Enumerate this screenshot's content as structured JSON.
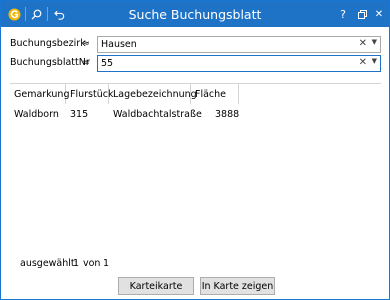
{
  "window": {
    "title": "Suche Buchungsblatt",
    "help_label": "?",
    "close_label": "✕"
  },
  "form": {
    "bezirk_label": "Buchungsbezirk",
    "bezirk_operator": "≈",
    "bezirk_value": "Hausen",
    "nr_label": "BuchungsblattNr",
    "nr_operator": "=",
    "nr_value": "55",
    "clear_glyph": "✕",
    "dropdown_glyph": "▼"
  },
  "table": {
    "columns": [
      "Gemarkung",
      "Flurstück",
      "Lagebezeichnung",
      "Fläche"
    ],
    "rows": [
      [
        "Waldborn",
        "315",
        "Waldbachtalstraße",
        "3888"
      ]
    ]
  },
  "status": {
    "selected_label": "ausgewählt:",
    "selected_count": "1",
    "of_label": "von",
    "total_count": "1"
  },
  "buttons": {
    "karteikarte": "Karteikarte",
    "in_karte_zeigen": "In Karte zeigen"
  },
  "colors": {
    "titlebar": "#1f73c7",
    "app_icon": "#f5b800"
  },
  "icons": {
    "app": "app-logo-icon",
    "search": "search-icon",
    "undo": "undo-icon",
    "restore": "restore-window-icon"
  }
}
